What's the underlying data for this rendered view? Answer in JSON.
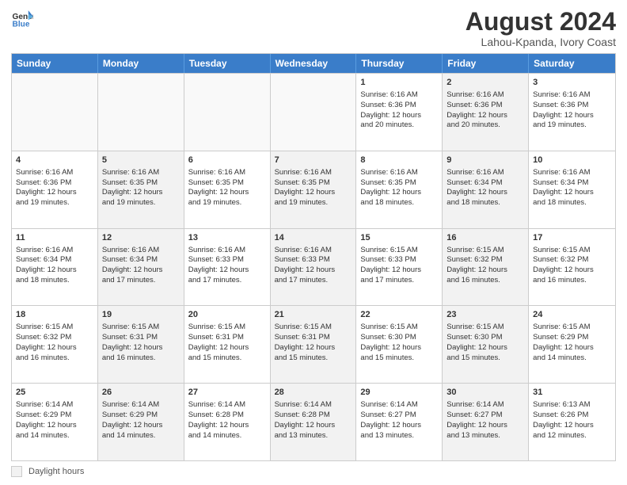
{
  "header": {
    "logo_line1": "General",
    "logo_line2": "Blue",
    "month": "August 2024",
    "location": "Lahou-Kpanda, Ivory Coast"
  },
  "days_of_week": [
    "Sunday",
    "Monday",
    "Tuesday",
    "Wednesday",
    "Thursday",
    "Friday",
    "Saturday"
  ],
  "weeks": [
    [
      {
        "day": "",
        "info": "",
        "shaded": false,
        "empty": true
      },
      {
        "day": "",
        "info": "",
        "shaded": false,
        "empty": true
      },
      {
        "day": "",
        "info": "",
        "shaded": false,
        "empty": true
      },
      {
        "day": "",
        "info": "",
        "shaded": false,
        "empty": true
      },
      {
        "day": "1",
        "info": "Sunrise: 6:16 AM\nSunset: 6:36 PM\nDaylight: 12 hours\nand 20 minutes.",
        "shaded": false,
        "empty": false
      },
      {
        "day": "2",
        "info": "Sunrise: 6:16 AM\nSunset: 6:36 PM\nDaylight: 12 hours\nand 20 minutes.",
        "shaded": true,
        "empty": false
      },
      {
        "day": "3",
        "info": "Sunrise: 6:16 AM\nSunset: 6:36 PM\nDaylight: 12 hours\nand 19 minutes.",
        "shaded": false,
        "empty": false
      }
    ],
    [
      {
        "day": "4",
        "info": "Sunrise: 6:16 AM\nSunset: 6:36 PM\nDaylight: 12 hours\nand 19 minutes.",
        "shaded": false,
        "empty": false
      },
      {
        "day": "5",
        "info": "Sunrise: 6:16 AM\nSunset: 6:35 PM\nDaylight: 12 hours\nand 19 minutes.",
        "shaded": true,
        "empty": false
      },
      {
        "day": "6",
        "info": "Sunrise: 6:16 AM\nSunset: 6:35 PM\nDaylight: 12 hours\nand 19 minutes.",
        "shaded": false,
        "empty": false
      },
      {
        "day": "7",
        "info": "Sunrise: 6:16 AM\nSunset: 6:35 PM\nDaylight: 12 hours\nand 19 minutes.",
        "shaded": true,
        "empty": false
      },
      {
        "day": "8",
        "info": "Sunrise: 6:16 AM\nSunset: 6:35 PM\nDaylight: 12 hours\nand 18 minutes.",
        "shaded": false,
        "empty": false
      },
      {
        "day": "9",
        "info": "Sunrise: 6:16 AM\nSunset: 6:34 PM\nDaylight: 12 hours\nand 18 minutes.",
        "shaded": true,
        "empty": false
      },
      {
        "day": "10",
        "info": "Sunrise: 6:16 AM\nSunset: 6:34 PM\nDaylight: 12 hours\nand 18 minutes.",
        "shaded": false,
        "empty": false
      }
    ],
    [
      {
        "day": "11",
        "info": "Sunrise: 6:16 AM\nSunset: 6:34 PM\nDaylight: 12 hours\nand 18 minutes.",
        "shaded": false,
        "empty": false
      },
      {
        "day": "12",
        "info": "Sunrise: 6:16 AM\nSunset: 6:34 PM\nDaylight: 12 hours\nand 17 minutes.",
        "shaded": true,
        "empty": false
      },
      {
        "day": "13",
        "info": "Sunrise: 6:16 AM\nSunset: 6:33 PM\nDaylight: 12 hours\nand 17 minutes.",
        "shaded": false,
        "empty": false
      },
      {
        "day": "14",
        "info": "Sunrise: 6:16 AM\nSunset: 6:33 PM\nDaylight: 12 hours\nand 17 minutes.",
        "shaded": true,
        "empty": false
      },
      {
        "day": "15",
        "info": "Sunrise: 6:15 AM\nSunset: 6:33 PM\nDaylight: 12 hours\nand 17 minutes.",
        "shaded": false,
        "empty": false
      },
      {
        "day": "16",
        "info": "Sunrise: 6:15 AM\nSunset: 6:32 PM\nDaylight: 12 hours\nand 16 minutes.",
        "shaded": true,
        "empty": false
      },
      {
        "day": "17",
        "info": "Sunrise: 6:15 AM\nSunset: 6:32 PM\nDaylight: 12 hours\nand 16 minutes.",
        "shaded": false,
        "empty": false
      }
    ],
    [
      {
        "day": "18",
        "info": "Sunrise: 6:15 AM\nSunset: 6:32 PM\nDaylight: 12 hours\nand 16 minutes.",
        "shaded": false,
        "empty": false
      },
      {
        "day": "19",
        "info": "Sunrise: 6:15 AM\nSunset: 6:31 PM\nDaylight: 12 hours\nand 16 minutes.",
        "shaded": true,
        "empty": false
      },
      {
        "day": "20",
        "info": "Sunrise: 6:15 AM\nSunset: 6:31 PM\nDaylight: 12 hours\nand 15 minutes.",
        "shaded": false,
        "empty": false
      },
      {
        "day": "21",
        "info": "Sunrise: 6:15 AM\nSunset: 6:31 PM\nDaylight: 12 hours\nand 15 minutes.",
        "shaded": true,
        "empty": false
      },
      {
        "day": "22",
        "info": "Sunrise: 6:15 AM\nSunset: 6:30 PM\nDaylight: 12 hours\nand 15 minutes.",
        "shaded": false,
        "empty": false
      },
      {
        "day": "23",
        "info": "Sunrise: 6:15 AM\nSunset: 6:30 PM\nDaylight: 12 hours\nand 15 minutes.",
        "shaded": true,
        "empty": false
      },
      {
        "day": "24",
        "info": "Sunrise: 6:15 AM\nSunset: 6:29 PM\nDaylight: 12 hours\nand 14 minutes.",
        "shaded": false,
        "empty": false
      }
    ],
    [
      {
        "day": "25",
        "info": "Sunrise: 6:14 AM\nSunset: 6:29 PM\nDaylight: 12 hours\nand 14 minutes.",
        "shaded": false,
        "empty": false
      },
      {
        "day": "26",
        "info": "Sunrise: 6:14 AM\nSunset: 6:29 PM\nDaylight: 12 hours\nand 14 minutes.",
        "shaded": true,
        "empty": false
      },
      {
        "day": "27",
        "info": "Sunrise: 6:14 AM\nSunset: 6:28 PM\nDaylight: 12 hours\nand 14 minutes.",
        "shaded": false,
        "empty": false
      },
      {
        "day": "28",
        "info": "Sunrise: 6:14 AM\nSunset: 6:28 PM\nDaylight: 12 hours\nand 13 minutes.",
        "shaded": true,
        "empty": false
      },
      {
        "day": "29",
        "info": "Sunrise: 6:14 AM\nSunset: 6:27 PM\nDaylight: 12 hours\nand 13 minutes.",
        "shaded": false,
        "empty": false
      },
      {
        "day": "30",
        "info": "Sunrise: 6:14 AM\nSunset: 6:27 PM\nDaylight: 12 hours\nand 13 minutes.",
        "shaded": true,
        "empty": false
      },
      {
        "day": "31",
        "info": "Sunrise: 6:13 AM\nSunset: 6:26 PM\nDaylight: 12 hours\nand 12 minutes.",
        "shaded": false,
        "empty": false
      }
    ]
  ],
  "footer": {
    "label": "Daylight hours"
  }
}
